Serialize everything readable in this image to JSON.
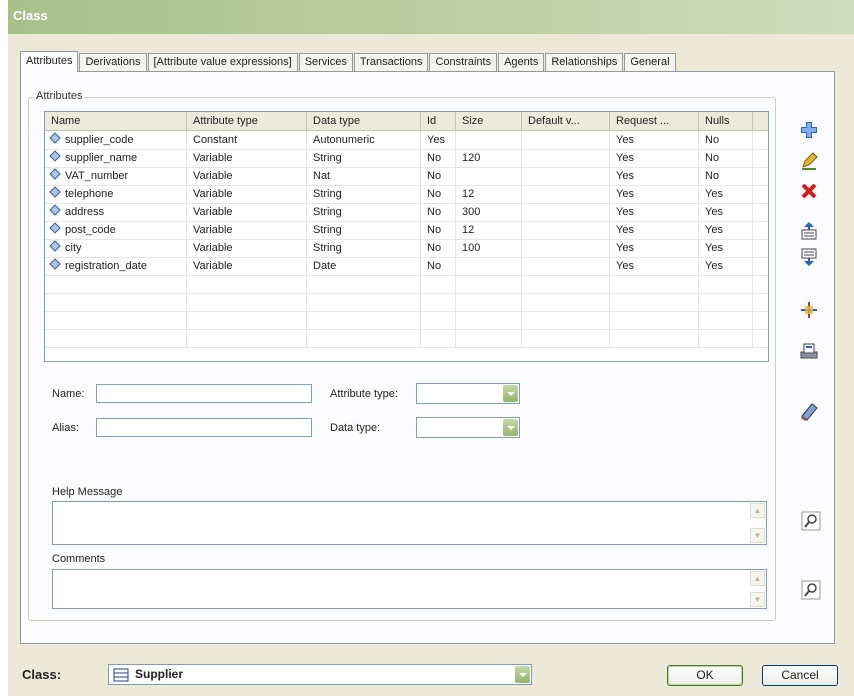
{
  "window": {
    "title": "Class"
  },
  "tabs": [
    "Attributes",
    "Derivations",
    "[Attribute value expressions]",
    "Services",
    "Transactions",
    "Constraints",
    "Agents",
    "Relationships",
    "General"
  ],
  "group": {
    "label": "Attributes"
  },
  "grid": {
    "headers": [
      "Name",
      "Attribute type",
      "Data type",
      "Id",
      "Size",
      "Default v...",
      "Request ...",
      "Nulls"
    ],
    "rows": [
      [
        "supplier_code",
        "Constant",
        "Autonumeric",
        "Yes",
        "",
        "",
        "Yes",
        "No"
      ],
      [
        "supplier_name",
        "Variable",
        "String",
        "No",
        "120",
        "",
        "Yes",
        "No"
      ],
      [
        "VAT_number",
        "Variable",
        "Nat",
        "No",
        "",
        "",
        "Yes",
        "No"
      ],
      [
        "telephone",
        "Variable",
        "String",
        "No",
        "12",
        "",
        "Yes",
        "Yes"
      ],
      [
        "address",
        "Variable",
        "String",
        "No",
        "300",
        "",
        "Yes",
        "Yes"
      ],
      [
        "post_code",
        "Variable",
        "String",
        "No",
        "12",
        "",
        "Yes",
        "Yes"
      ],
      [
        "city",
        "Variable",
        "String",
        "No",
        "100",
        "",
        "Yes",
        "Yes"
      ],
      [
        "registration_date",
        "Variable",
        "Date",
        "No",
        "",
        "",
        "Yes",
        "Yes"
      ]
    ]
  },
  "form": {
    "name_label": "Name:",
    "alias_label": "Alias:",
    "attribute_type_label": "Attribute type:",
    "data_type_label": "Data type:",
    "help_label": "Help Message",
    "comments_label": "Comments"
  },
  "footer": {
    "class_label": "Class:",
    "class_value": "Supplier",
    "ok": "OK",
    "cancel": "Cancel"
  },
  "icons": [
    "add-icon",
    "edit-icon",
    "delete-icon",
    "move-up-icon",
    "move-down-icon",
    "insert-icon",
    "copy-icon",
    "eraser-icon",
    "zoom-icon",
    "class-icon"
  ]
}
